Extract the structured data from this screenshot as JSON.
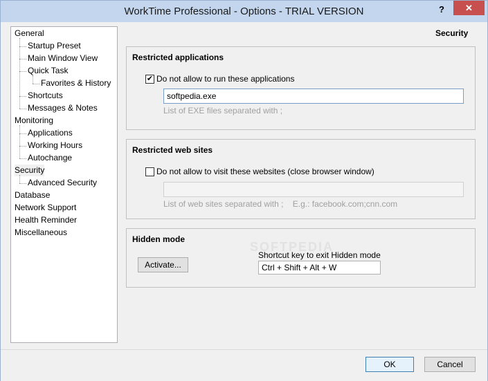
{
  "window": {
    "title": "WorkTime Professional - Options - TRIAL VERSION",
    "help_glyph": "?",
    "close_glyph": "✕"
  },
  "tree": {
    "items": [
      {
        "label": "General",
        "level": 0
      },
      {
        "label": "Startup Preset",
        "level": 1
      },
      {
        "label": "Main Window View",
        "level": 1
      },
      {
        "label": "Quick Task",
        "level": 1
      },
      {
        "label": "Favorites & History",
        "level": 2
      },
      {
        "label": "Shortcuts",
        "level": 1
      },
      {
        "label": "Messages & Notes",
        "level": 1
      },
      {
        "label": "Monitoring",
        "level": 0
      },
      {
        "label": "Applications",
        "level": 1
      },
      {
        "label": "Working Hours",
        "level": 1
      },
      {
        "label": "Autochange",
        "level": 1
      },
      {
        "label": "Security",
        "level": 0,
        "selected": true
      },
      {
        "label": "Advanced Security",
        "level": 1
      },
      {
        "label": "Database",
        "level": 0
      },
      {
        "label": "Network Support",
        "level": 0
      },
      {
        "label": "Health Reminder",
        "level": 0
      },
      {
        "label": "Miscellaneous",
        "level": 0
      }
    ]
  },
  "page": {
    "title": "Security",
    "watermark": "SOFTPEDIA"
  },
  "restricted_apps": {
    "title": "Restricted applications",
    "checkbox_label": "Do not allow to run these applications",
    "checked": true,
    "check_glyph": "✔",
    "value": "softpedia.exe",
    "hint": "List of EXE files separated with ;"
  },
  "restricted_sites": {
    "title": "Restricted web sites",
    "checkbox_label": "Do not allow to visit these websites (close browser window)",
    "checked": false,
    "value": "",
    "hint": "List of web sites separated with ;    E.g.: facebook.com;cnn.com"
  },
  "hidden_mode": {
    "title": "Hidden mode",
    "activate_label": "Activate...",
    "shortcut_label": "Shortcut key to exit Hidden mode",
    "shortcut_value": "Ctrl + Shift + Alt + W"
  },
  "footer": {
    "ok_label": "OK",
    "cancel_label": "Cancel"
  }
}
